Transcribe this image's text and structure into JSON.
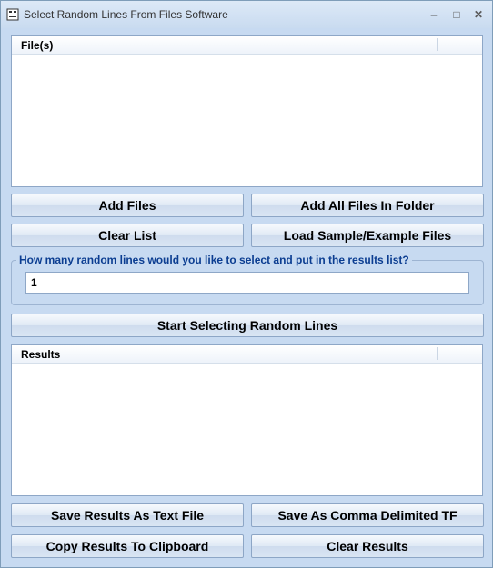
{
  "window": {
    "title": "Select Random Lines From Files Software",
    "minimize_glyph": "–",
    "maximize_glyph": "□",
    "close_glyph": "✕",
    "icon": "app-icon"
  },
  "files_list": {
    "column_header": "File(s)"
  },
  "buttons": {
    "add_files": "Add Files",
    "add_all_files_in_folder": "Add All Files In Folder",
    "clear_list": "Clear List",
    "load_sample": "Load Sample/Example Files",
    "start": "Start Selecting Random Lines",
    "save_text": "Save Results As Text File",
    "save_csv": "Save As Comma Delimited TF",
    "copy_clipboard": "Copy Results To Clipboard",
    "clear_results": "Clear Results"
  },
  "count_group": {
    "label": "How many random lines would you like to select and put in the results list?",
    "value": "1"
  },
  "results_list": {
    "column_header": "Results"
  },
  "colors": {
    "background": "#c7daf1",
    "group_label": "#0b3d91"
  }
}
